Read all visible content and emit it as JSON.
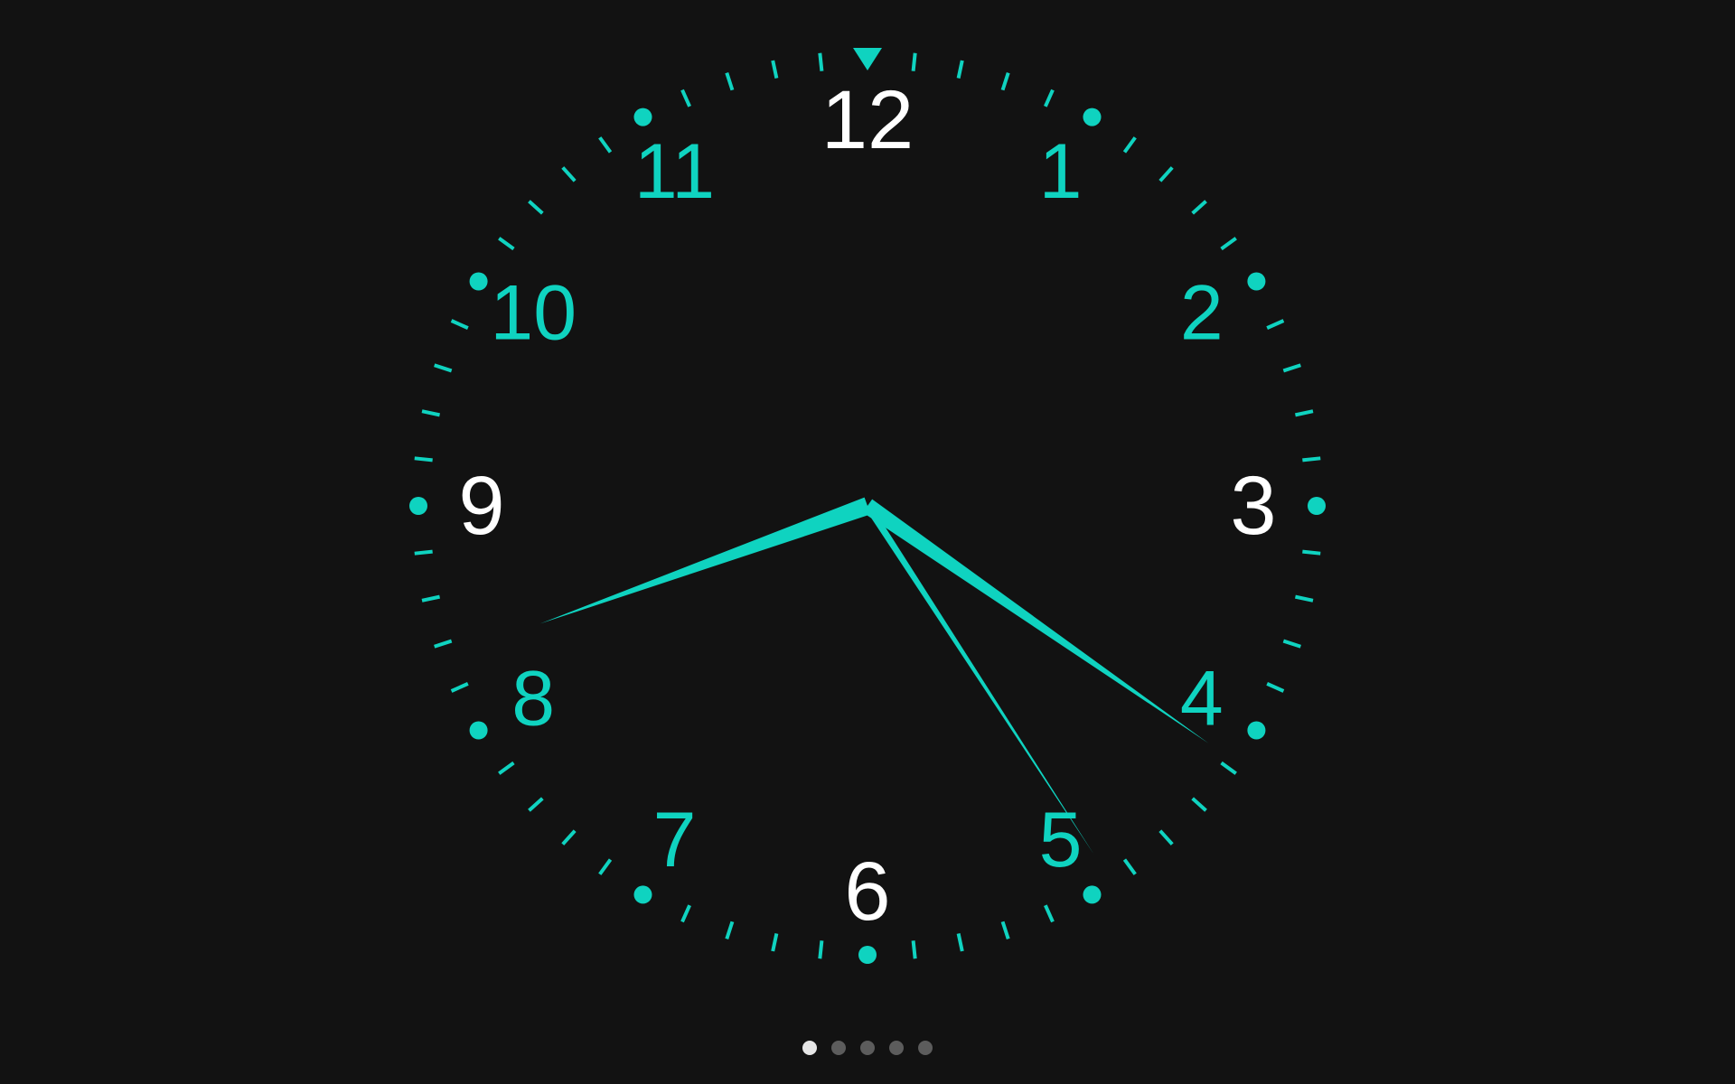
{
  "colors": {
    "background": "#121212",
    "accent": "#0fd3c0",
    "major_numeral": "#ffffff",
    "page_dot_inactive": "#5c5c5c",
    "page_dot_active": "#e6e6e6"
  },
  "clock": {
    "numerals": [
      {
        "label": "12",
        "value": 12,
        "major": true
      },
      {
        "label": "1",
        "value": 1,
        "major": false
      },
      {
        "label": "2",
        "value": 2,
        "major": false
      },
      {
        "label": "3",
        "value": 3,
        "major": true
      },
      {
        "label": "4",
        "value": 4,
        "major": false
      },
      {
        "label": "5",
        "value": 5,
        "major": false
      },
      {
        "label": "6",
        "value": 6,
        "major": true
      },
      {
        "label": "7",
        "value": 7,
        "major": false
      },
      {
        "label": "8",
        "value": 8,
        "major": false
      },
      {
        "label": "9",
        "value": 9,
        "major": true
      },
      {
        "label": "10",
        "value": 10,
        "major": false
      },
      {
        "label": "11",
        "value": 11,
        "major": false
      }
    ],
    "time": {
      "hours": 8,
      "minutes": 20.4,
      "seconds": 24.5
    },
    "top_marker_icon": "triangle-down-icon"
  },
  "pager": {
    "count": 5,
    "active_index": 0
  }
}
